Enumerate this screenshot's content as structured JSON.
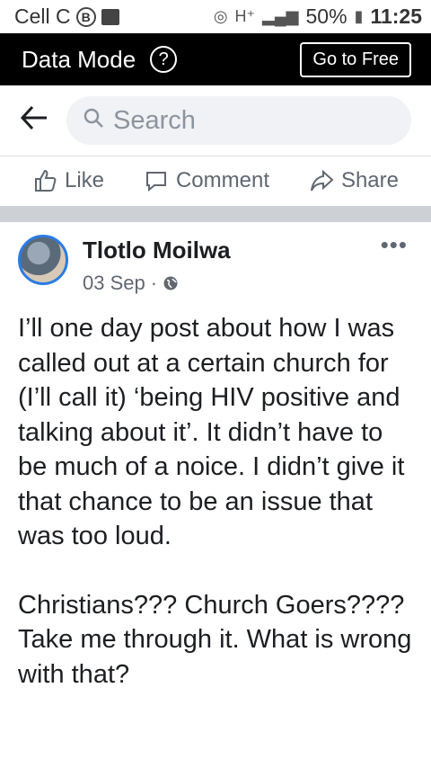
{
  "status_bar": {
    "carrier": "Cell C",
    "network_type": "H⁺",
    "battery": "50%",
    "time": "11:25",
    "icons": [
      "b-badge-icon",
      "image-icon",
      "data-saver-icon",
      "signal-icon",
      "battery-icon"
    ]
  },
  "data_mode_bar": {
    "title": "Data Mode",
    "help_label": "?",
    "go_free_label": "Go to Free"
  },
  "search_bar": {
    "back_icon": "back-arrow-icon",
    "placeholder": "Search"
  },
  "actions": {
    "like_label": "Like",
    "comment_label": "Comment",
    "share_label": "Share"
  },
  "post": {
    "author": "Tlotlo Moilwa",
    "date": "03 Sep",
    "separator": "·",
    "privacy_icon": "globe-icon",
    "more_label": "•••",
    "paragraphs": [
      "I’ll one day post about how I was called out at a certain church for (I’ll call it) ‘being HIV positive and talking about it’. It didn’t have to be much of a noice. I didn’t give it that chance to be an issue that was too loud.",
      "Christians??? Church Goers???? Take me through it. What is wrong with that?"
    ]
  },
  "colors": {
    "accent": "#2b7be4",
    "bar_black": "#000000",
    "search_bg": "#f0f2f5",
    "separator": "#cdd0d5"
  }
}
